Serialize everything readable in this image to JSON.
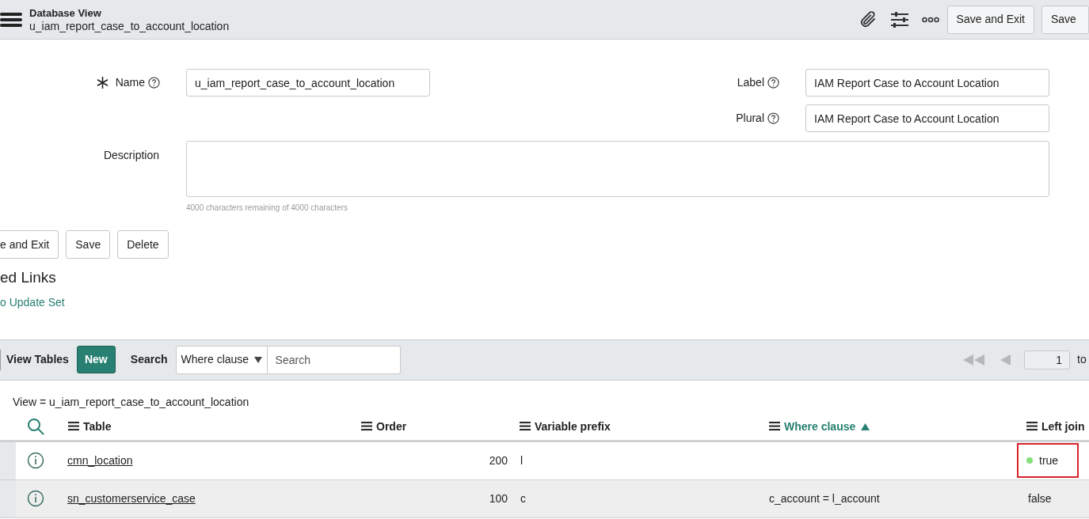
{
  "header": {
    "title": "Database View",
    "subtitle": "u_iam_report_case_to_account_location",
    "buttons": [
      "Save and Exit",
      "Save"
    ]
  },
  "form": {
    "name": {
      "label": "Name",
      "value": "u_iam_report_case_to_account_location",
      "required": true
    },
    "label": {
      "label": "Label",
      "value": "IAM Report Case to Account Location"
    },
    "plural": {
      "label": "Plural",
      "value": "IAM Report Case to Account Location"
    },
    "description": {
      "label": "Description",
      "hint": "4000 characters remaining of 4000 characters"
    }
  },
  "form_buttons": [
    "e and Exit",
    "Save",
    "Delete"
  ],
  "related_links": {
    "heading": "ed Links",
    "links": [
      "o Update Set"
    ]
  },
  "list": {
    "title": "View Tables",
    "new_button": "New",
    "search_label": "Search",
    "search_field": "Where clause",
    "search_placeholder": "Search",
    "page": "1",
    "page_to": "to",
    "breadcrumb": "View = u_iam_report_case_to_account_location",
    "columns": [
      {
        "label": "Table",
        "sorted": false
      },
      {
        "label": "Order",
        "sorted": false
      },
      {
        "label": "Variable prefix",
        "sorted": false
      },
      {
        "label": "Where clause",
        "sorted": true
      },
      {
        "label": "Left join",
        "sorted": false
      }
    ],
    "rows": [
      {
        "table": "cmn_location",
        "order": "200",
        "variable_prefix": "l",
        "where_clause": "",
        "left_join": "true",
        "dot": true,
        "highlighted": true
      },
      {
        "table": "sn_customerservice_case",
        "order": "100",
        "variable_prefix": "c",
        "where_clause": "c_account = l_account",
        "left_join": "false",
        "dot": false,
        "highlighted": false
      }
    ]
  }
}
